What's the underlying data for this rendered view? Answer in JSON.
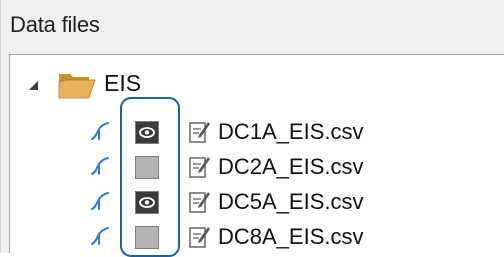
{
  "panel": {
    "title": "Data files"
  },
  "tree": {
    "root": {
      "label": "EIS",
      "expanded": true
    },
    "files": [
      {
        "label": "DC1A_EIS.csv",
        "visible": true
      },
      {
        "label": "DC2A_EIS.csv",
        "visible": false
      },
      {
        "label": "DC5A_EIS.csv",
        "visible": true
      },
      {
        "label": "DC8A_EIS.csv",
        "visible": false
      }
    ]
  },
  "colors": {
    "highlight": "#1f5f9b",
    "plot_icon": "#2f7fd0",
    "folder": "#e6b35a",
    "toggle_on": "#3a3a3a",
    "toggle_off": "#b4b4b4"
  }
}
